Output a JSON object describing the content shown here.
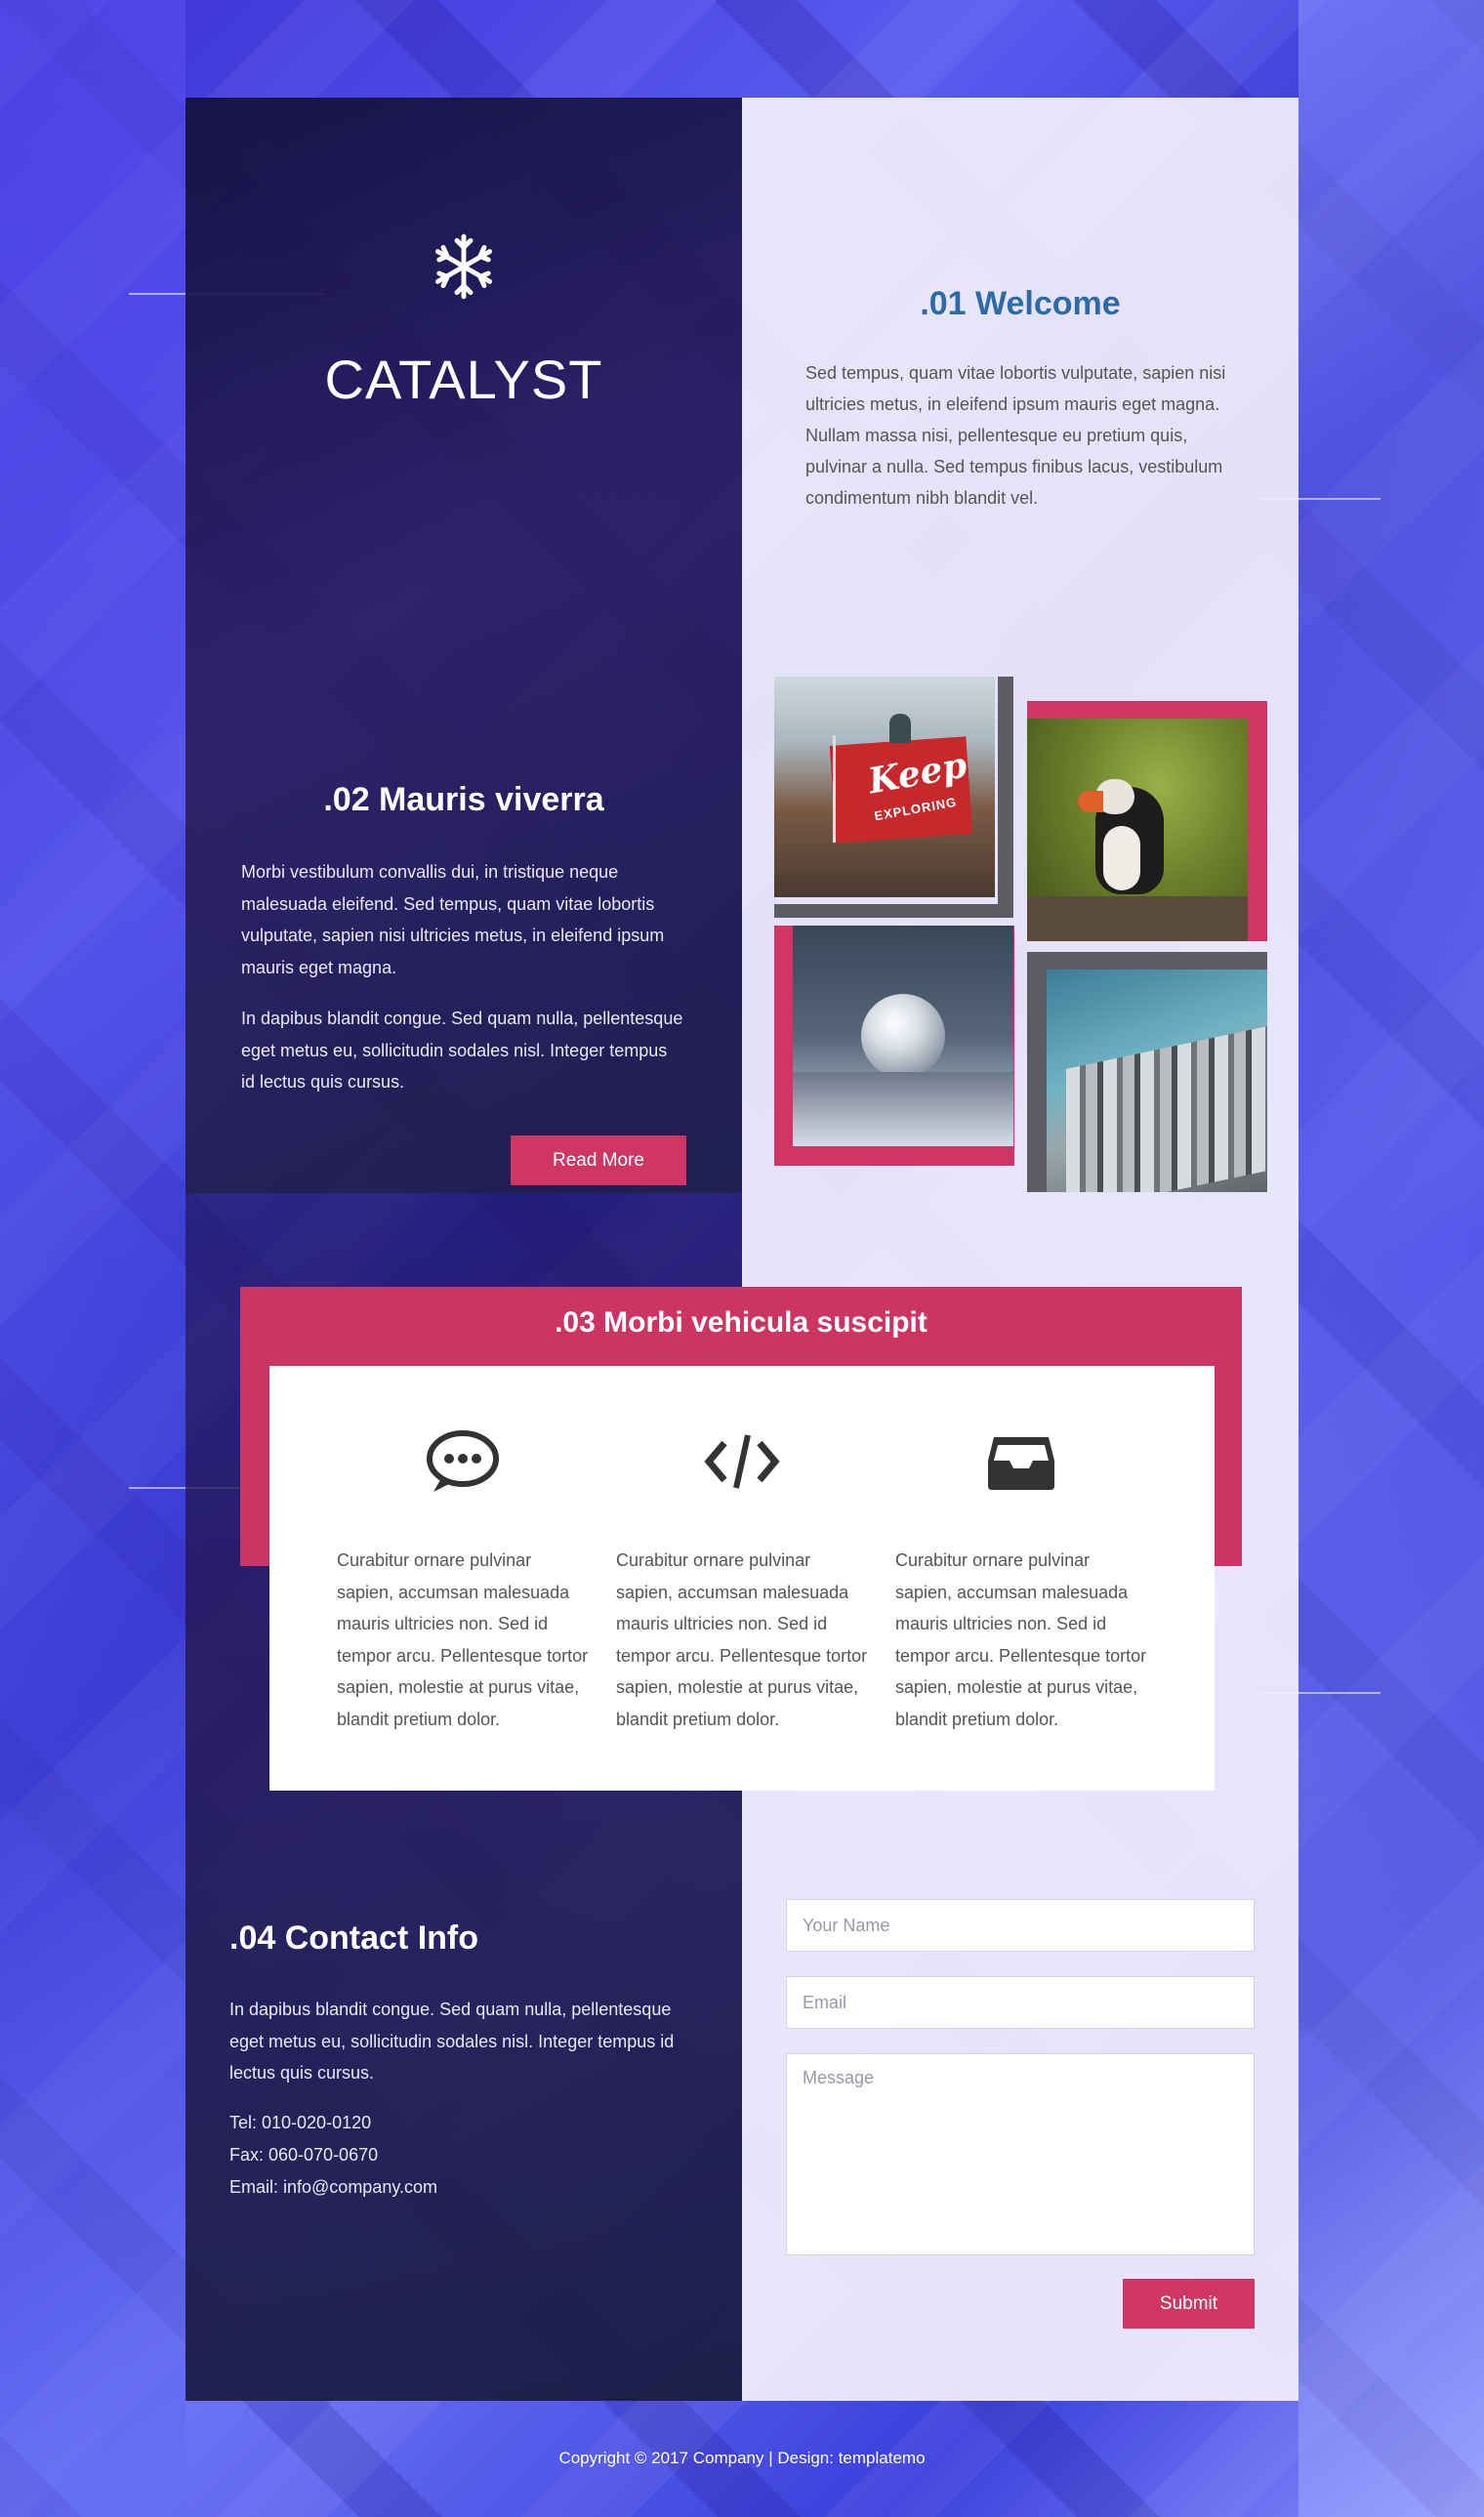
{
  "brand": {
    "name": "CATALYST",
    "icon": "snowflake-icon"
  },
  "welcome": {
    "title": ".01 Welcome",
    "text": "Sed tempus, quam vitae lobortis vulputate, sapien nisi ultricies metus, in eleifend ipsum mauris eget magna. Nullam massa nisi, pellentesque eu pretium quis, pulvinar a nulla. Sed tempus finibus lacus, vestibulum condimentum nibh blandit vel."
  },
  "section2": {
    "title": ".02 Mauris viverra",
    "p1": "Morbi vestibulum convallis dui, in tristique neque malesuada eleifend. Sed tempus, quam vitae lobortis vulputate, sapien nisi ultricies metus, in eleifend ipsum mauris eget magna.",
    "p2": "In dapibus blandit congue. Sed quam nulla, pellentesque eget metus eu, sollicitudin sodales nisl. Integer tempus id lectus quis cursus.",
    "button": "Read More"
  },
  "gallery": {
    "photos": [
      {
        "name": "keep-exploring-flag",
        "flag_text_1": "Keep",
        "flag_text_2": "EXPLORING"
      },
      {
        "name": "puffin"
      },
      {
        "name": "frozen-bubble"
      },
      {
        "name": "city-aerial"
      }
    ]
  },
  "section3": {
    "title": ".03 Morbi vehicula suscipit",
    "features": [
      {
        "icon": "chat-bubble-icon",
        "text": "Curabitur ornare pulvinar sapien, accumsan malesuada mauris ultricies non. Sed id tempor arcu. Pellentesque tortor sapien, molestie at purus vitae, blandit pretium dolor."
      },
      {
        "icon": "code-icon",
        "text": "Curabitur ornare pulvinar sapien, accumsan malesuada mauris ultricies non. Sed id tempor arcu. Pellentesque tortor sapien, molestie at purus vitae, blandit pretium dolor."
      },
      {
        "icon": "inbox-icon",
        "text": "Curabitur ornare pulvinar sapien, accumsan malesuada mauris ultricies non. Sed id tempor arcu. Pellentesque tortor sapien, molestie at purus vitae, blandit pretium dolor."
      }
    ]
  },
  "contact": {
    "title": ".04 Contact Info",
    "text": "In dapibus blandit congue. Sed quam nulla, pellentesque eget metus eu, sollicitudin sodales nisl. Integer tempus id lectus quis cursus.",
    "tel": "Tel: 010-020-0120",
    "fax": "Fax: 060-070-0670",
    "email": "Email: info@company.com",
    "form": {
      "name_placeholder": "Your Name",
      "email_placeholder": "Email",
      "message_placeholder": "Message",
      "submit": "Submit"
    }
  },
  "footer": {
    "text": "Copyright © 2017 Company | Design: templatemo"
  },
  "colors": {
    "accent": "#cf3565",
    "title_blue": "#2e6aa6",
    "dark_panel": "#1c1846",
    "light_panel": "#f2f0fc"
  }
}
